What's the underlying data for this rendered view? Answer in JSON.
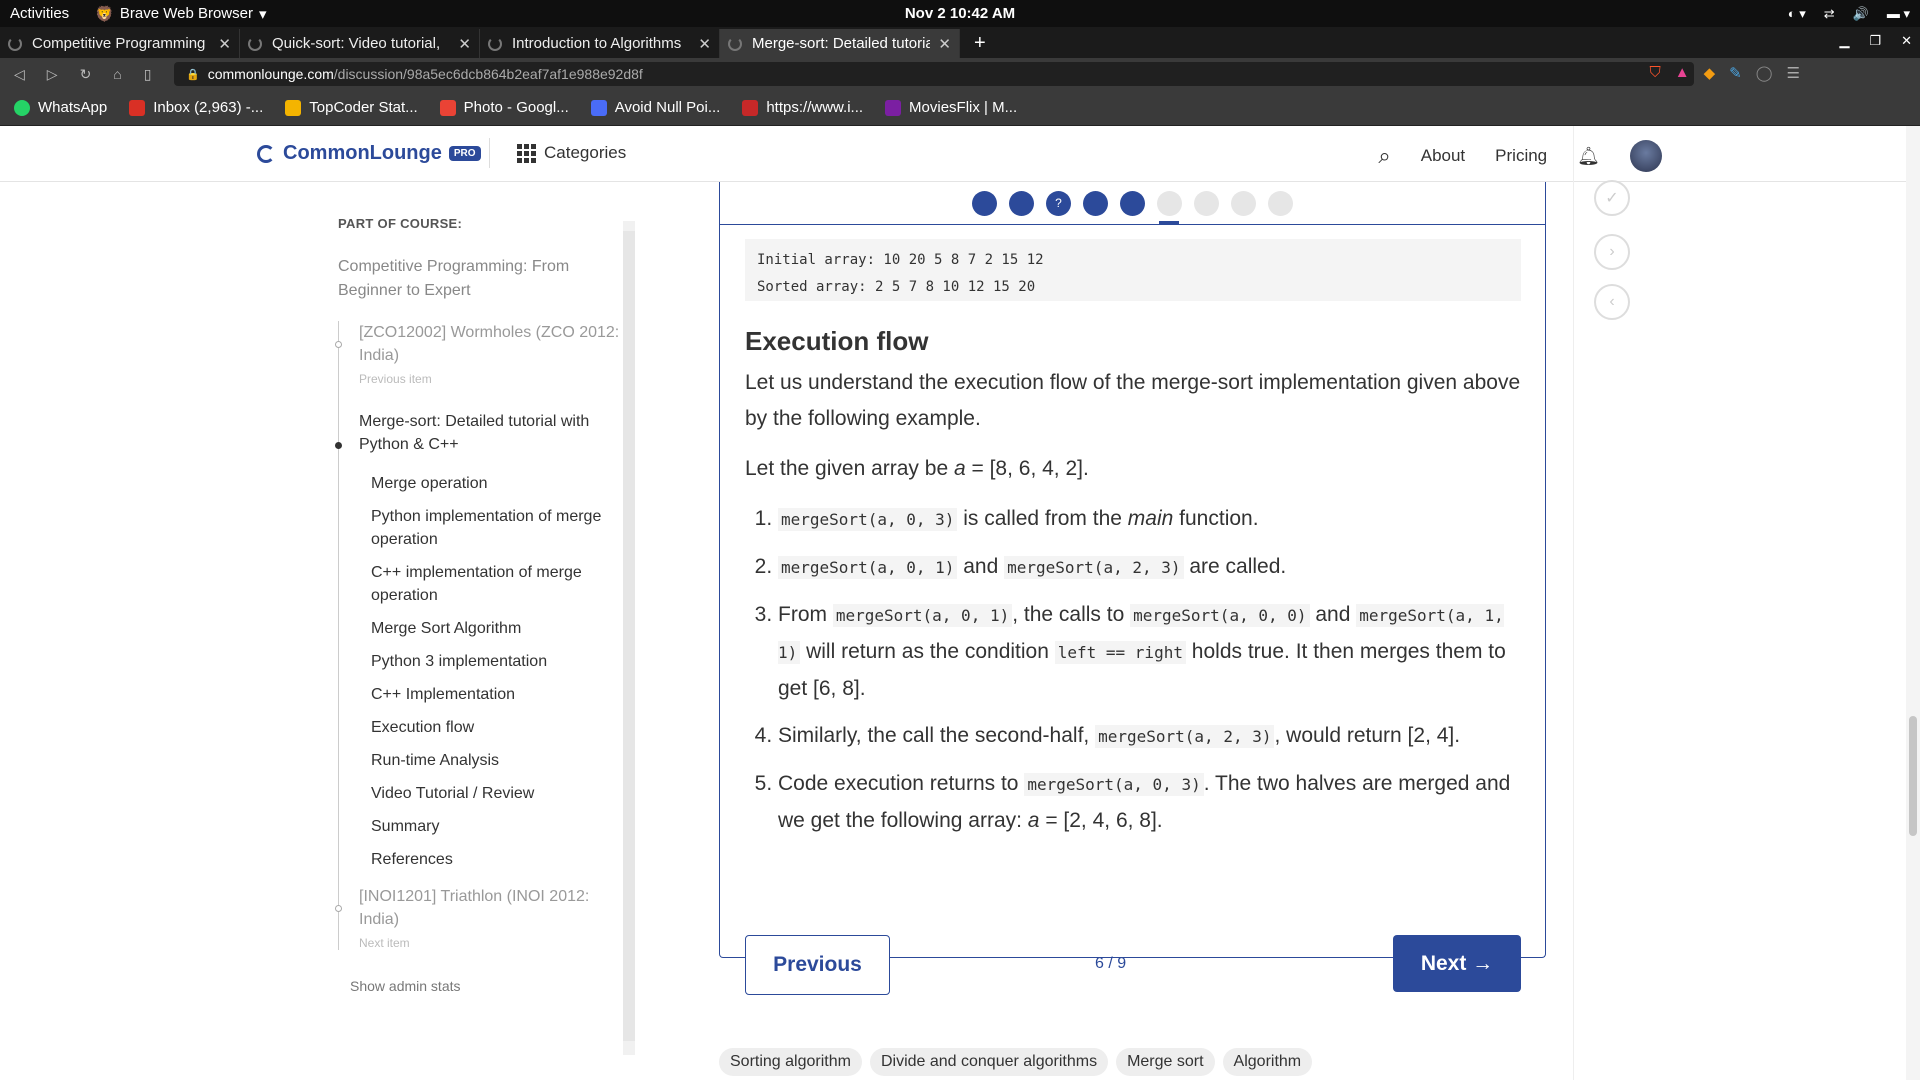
{
  "os": {
    "activities": "Activities",
    "app_name": "Brave Web Browser",
    "clock": "Nov 2  10:42 AM"
  },
  "tabs": [
    {
      "title": "Competitive Programming"
    },
    {
      "title": "Quick-sort: Video tutorial,"
    },
    {
      "title": "Introduction to Algorithms"
    },
    {
      "title": "Merge-sort: Detailed tutorial"
    }
  ],
  "address": {
    "domain": "commonlounge.com",
    "path": "/discussion/98a5ec6dcb864b2eaf7af1e988e92d8f"
  },
  "bookmarks": [
    {
      "label": "WhatsApp",
      "color": "#25d366"
    },
    {
      "label": "Inbox (2,963) -...",
      "color": "#d93025"
    },
    {
      "label": "TopCoder Stat...",
      "color": "#f4b400"
    },
    {
      "label": "Photo - Googl...",
      "color": "#ea4335"
    },
    {
      "label": "Avoid Null Poi...",
      "color": "#4a6cf7"
    },
    {
      "label": "https://www.i...",
      "color": "#c62828"
    },
    {
      "label": "MoviesFlix | M...",
      "color": "#7b1fa2"
    }
  ],
  "header": {
    "logo": "CommonLounge",
    "pro": "PRO",
    "categories": "Categories",
    "about": "About",
    "pricing": "Pricing"
  },
  "sidebar": {
    "title": "PART OF COURSE:",
    "course": "Competitive Programming: From Beginner to Expert",
    "previous": {
      "title": "[ZCO12002] Wormholes (ZCO 2012: India)",
      "sub": "Previous item"
    },
    "current": "Merge-sort: Detailed tutorial with Python & C++",
    "sections": [
      "Merge operation",
      "Python implementation of merge operation",
      "C++ implementation of merge operation",
      "Merge Sort Algorithm",
      "Python 3 implementation",
      "C++ Implementation",
      "Execution flow",
      "Run-time Analysis",
      "Video Tutorial / Review",
      "Summary",
      "References"
    ],
    "next": {
      "title": "[INOI1201] Triathlon (INOI 2012: India)",
      "sub": "Next item"
    },
    "admin": "Show admin stats"
  },
  "progress": {
    "total": 9,
    "current": 6,
    "quiz_label": "?"
  },
  "output": {
    "line1": "Initial array: 10 20 5 8 7 2 15 12",
    "line2": "Sorted array: 2 5 7 8 10 12 15 20"
  },
  "article": {
    "heading": "Execution flow",
    "intro": "Let us understand the execution flow of the merge-sort implementation given above by the following example.",
    "given_pre": "Let the given array be ",
    "given_var": "a",
    "given_post": " = [8, 6, 4, 2].",
    "steps": {
      "s1_code": "mergeSort(a, 0, 3)",
      "s1_mid": " is called from the ",
      "s1_em": "main",
      "s1_end": " function.",
      "s2_code1": "mergeSort(a, 0, 1)",
      "s2_mid": " and ",
      "s2_code2": "mergeSort(a, 2, 3)",
      "s2_end": " are called.",
      "s3_pre": "From ",
      "s3_code1": "mergeSort(a, 0, 1)",
      "s3_mid1": ", the calls to ",
      "s3_code2": "mergeSort(a, 0, 0)",
      "s3_mid2": " and ",
      "s3_code3": "mergeSort(a, 1, 1)",
      "s3_mid3": " will return as the condition ",
      "s3_code4": "left == right",
      "s3_end": " holds true. It then merges them to get [6, 8].",
      "s4_pre": "Similarly, the call the second-half, ",
      "s4_code": "mergeSort(a, 2, 3)",
      "s4_end": ", would return [2, 4].",
      "s5_pre": "Code execution returns to ",
      "s5_code": "mergeSort(a, 0, 3)",
      "s5_mid": ". The two halves are merged and we get the following array: ",
      "s5_var": "a",
      "s5_end": " = [2, 4, 6, 8]."
    }
  },
  "pager": {
    "previous": "Previous",
    "count": "6 / 9",
    "next": "Next →"
  },
  "tags": [
    "Sorting algorithm",
    "Divide and conquer algorithms",
    "Merge sort",
    "Algorithm"
  ]
}
